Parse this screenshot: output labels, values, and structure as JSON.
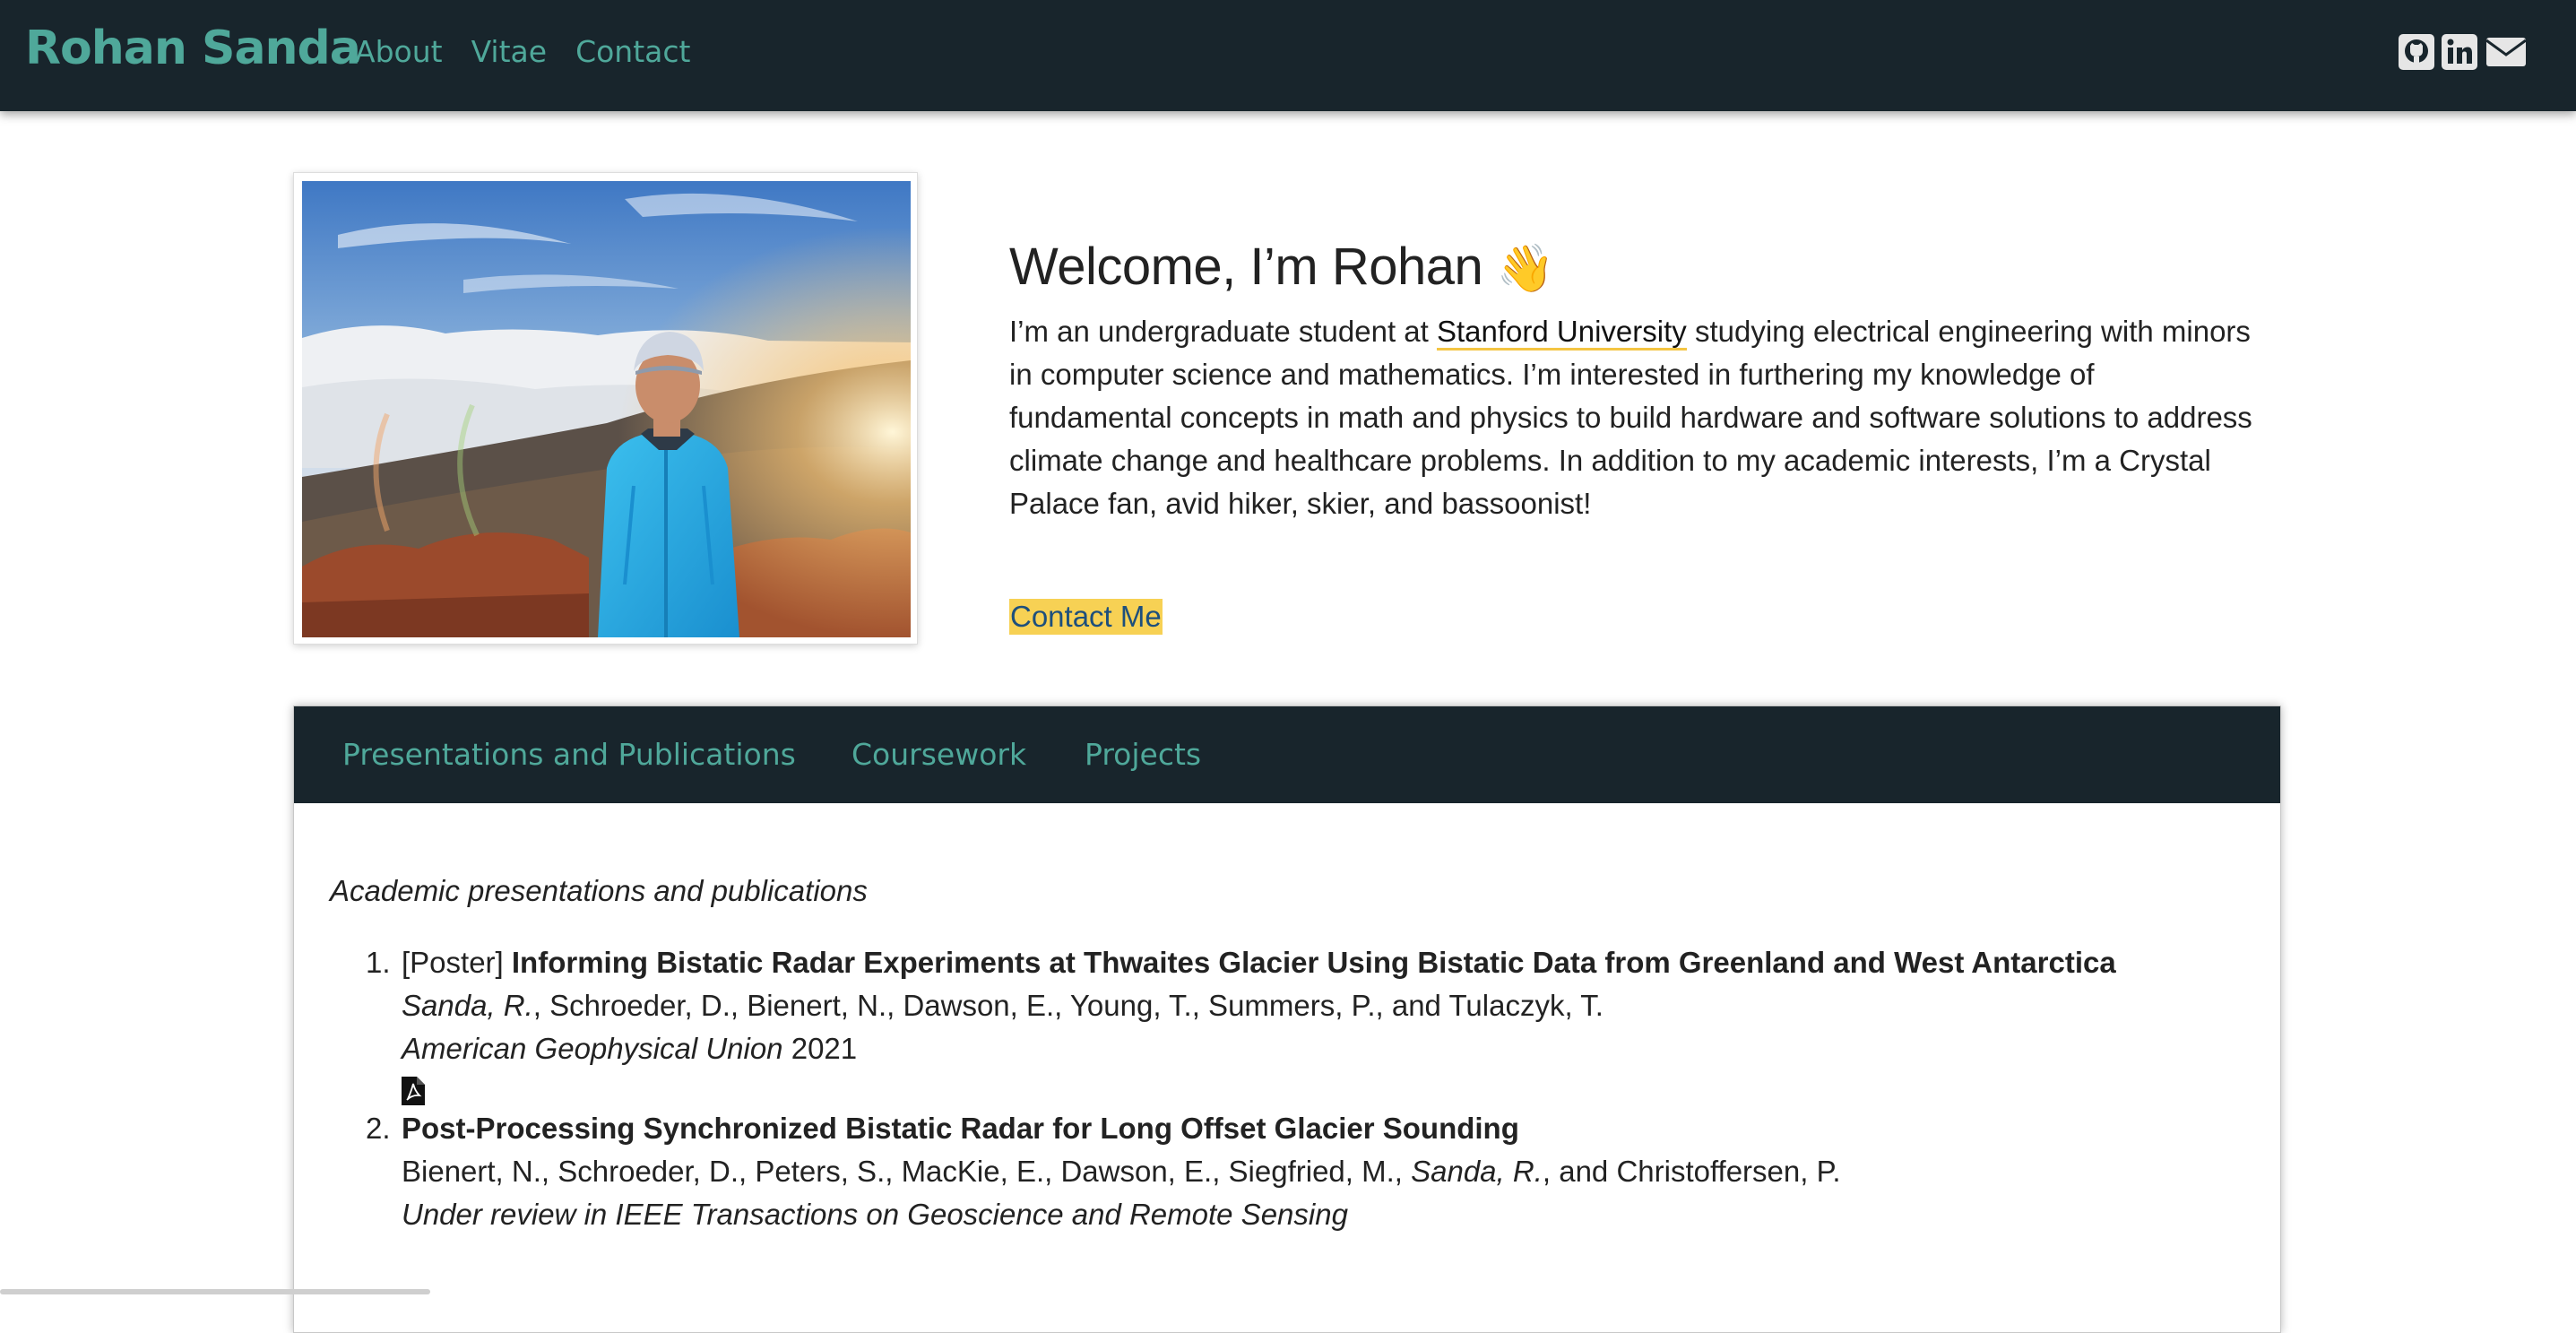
{
  "navbar": {
    "brand": "Rohan Sanda",
    "links": [
      "About",
      "Vitae",
      "Contact"
    ],
    "social_icons": [
      "github-icon",
      "linkedin-icon",
      "envelope-icon"
    ]
  },
  "hero": {
    "title": "Welcome, I’m Rohan",
    "wave_emoji": "👋",
    "intro_before": "I’m an undergraduate student at ",
    "university": "Stanford University",
    "intro_after": " studying electrical engineering with minors in computer science and mathematics. I’m interested in furthering my knowledge of fundamental concepts in math and physics to build hardware and software solutions to address climate change and healthcare problems. In addition to my academic interests, I’m a Crystal Palace fan, avid hiker, skier, and bassoonist!",
    "contact_button": "Contact Me"
  },
  "tabs": [
    "Presentations and Publications",
    "Coursework",
    "Projects"
  ],
  "publications": {
    "intro": "Academic presentations and publications",
    "items": [
      {
        "number": "1.",
        "prefix": "[Poster] ",
        "title": "Informing Bistatic Radar Experiments at Thwaites Glacier Using Bistatic Data from Greenland and West Antarctica",
        "author_self": "Sanda, R.",
        "authors_rest": ", Schroeder, D., Bienert, N., Dawson, E., Young, T., Summers, P., and Tulaczyk, T.",
        "venue": "American Geophysical Union",
        "year": " 2021"
      },
      {
        "number": "2.",
        "title": "Post-Processing Synchronized Bistatic Radar for Long Offset Glacier Sounding",
        "authors_before": "Bienert, N., Schroeder, D., Peters, S., MacKie, E., Dawson, E., Siegfried, M., ",
        "author_self": "Sanda, R.",
        "authors_after": ", and Christoffersen, P.",
        "venue": "Under review in IEEE Transactions on Geoscience and Remote Sensing"
      }
    ]
  },
  "colors": {
    "navbar_bg": "#18252c",
    "accent_teal": "#4fa89a",
    "highlight_yellow": "#f7d154",
    "button_text": "#1d4f7c"
  }
}
